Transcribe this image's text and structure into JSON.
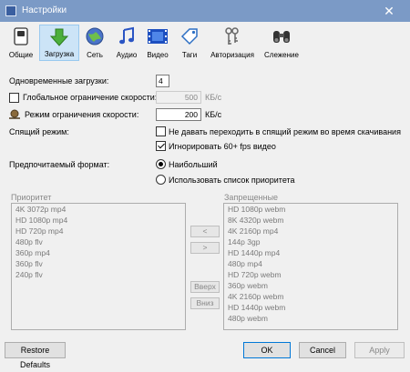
{
  "window": {
    "title": "Настройки",
    "close_glyph": "✕"
  },
  "toolbar": {
    "items": [
      {
        "label": "Общие",
        "icon": "switch-icon"
      },
      {
        "label": "Загрузка",
        "icon": "download-arrow-icon"
      },
      {
        "label": "Сеть",
        "icon": "globe-icon"
      },
      {
        "label": "Аудио",
        "icon": "music-note-icon"
      },
      {
        "label": "Видео",
        "icon": "film-icon"
      },
      {
        "label": "Таги",
        "icon": "tag-icon"
      },
      {
        "label": "Авторизация",
        "icon": "keys-icon"
      },
      {
        "label": "Слежение",
        "icon": "binoculars-icon"
      }
    ]
  },
  "downloads": {
    "simultaneous_label": "Одновременные загрузки:",
    "simultaneous_value": "4",
    "global_limit_label": "Глобальное ограничение скорости:",
    "global_limit_value": "500",
    "global_limit_unit": "КБ/с",
    "limit_mode_label": "Режим ограничения скорости:",
    "limit_mode_value": "200",
    "limit_mode_unit": "КБ/с",
    "sleep_label": "Спящий режим:",
    "sleep_option": "Не давать переходить в спящий режим во время скачивания",
    "ignore_fps_option": "Игнорировать 60+ fps видео",
    "format_label": "Предпочитаемый формат:",
    "format_best": "Наибольший",
    "format_priority": "Использовать список приоритета"
  },
  "priority": {
    "label": "Приоритет",
    "items": [
      "4K 3072p mp4",
      "HD 1080p mp4",
      "HD 720p mp4",
      "480p flv",
      "360p mp4",
      "360p flv",
      "240p flv"
    ]
  },
  "forbidden": {
    "label": "Запрещенные",
    "items": [
      "HD 1080p webm",
      "8K 4320p webm",
      "4K 2160p mp4",
      "144p 3gp",
      "HD 1440p mp4",
      "480p mp4",
      "HD 720p webm",
      "360p webm",
      "4K 2160p webm",
      "HD 1440p webm",
      "480p webm"
    ]
  },
  "list_buttons": {
    "left": "<",
    "right": ">",
    "up": "Вверх",
    "down": "Вниз"
  },
  "footer": {
    "restore": "Restore Defaults",
    "ok": "OK",
    "cancel": "Cancel",
    "apply": "Apply"
  },
  "colors": {
    "titlebar": "#7b9ac6",
    "active_tab": "#cce4f7",
    "accent": "#0078d7"
  }
}
